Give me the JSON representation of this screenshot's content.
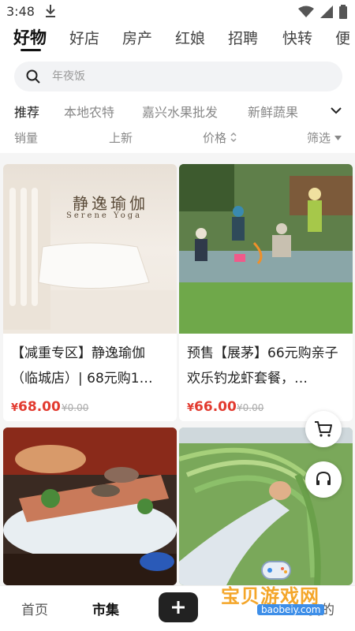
{
  "status_bar": {
    "time": "3:48"
  },
  "tabs": [
    {
      "label": "好物"
    },
    {
      "label": "好店"
    },
    {
      "label": "房产"
    },
    {
      "label": "红娘"
    },
    {
      "label": "招聘"
    },
    {
      "label": "快转"
    },
    {
      "label": "便"
    }
  ],
  "search": {
    "placeholder": "年夜饭"
  },
  "categories": [
    {
      "label": "推荐"
    },
    {
      "label": "本地农特"
    },
    {
      "label": "嘉兴水果批发"
    },
    {
      "label": "新鲜蔬果"
    }
  ],
  "sort": {
    "sales": "销量",
    "new": "上新",
    "price": "价格",
    "filter": "筛选"
  },
  "products": [
    {
      "title": "【减重专区】静逸瑜伽（临城店）| 68元购1…",
      "yen": "¥",
      "price": "68.00",
      "old_price": "¥0.00",
      "image_sign": "静逸瑜伽",
      "image_sign_en": "Serene Yoga"
    },
    {
      "title": "预售【展茅】66元购亲子欢乐钓龙虾套餐，…",
      "yen": "¥",
      "price": "66.00",
      "old_price": "¥0.00"
    }
  ],
  "bottom_nav": {
    "home": "首页",
    "market": "市集",
    "mine": "我的"
  },
  "watermark": {
    "text": "宝贝游戏网",
    "url": "baobeiy.com"
  },
  "colors": {
    "price_red": "#e23a2f",
    "active_text": "#111111",
    "muted": "#888888"
  }
}
